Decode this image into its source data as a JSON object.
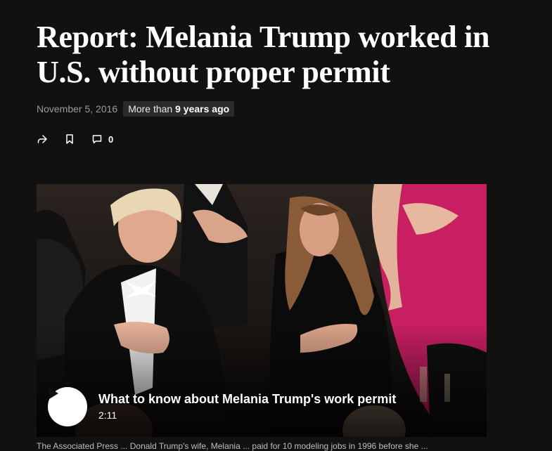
{
  "article": {
    "headline": "Report: Melania Trump worked in U.S. without proper permit",
    "date": "November 5, 2016",
    "age_prefix": "More than ",
    "age_value": "9 years ago"
  },
  "actions": {
    "share_icon": "share-icon",
    "bookmark_icon": "bookmark-icon",
    "comment_icon": "comment-icon",
    "comment_count": "0"
  },
  "video": {
    "title": "What to know about Melania Trump's work permit",
    "duration": "2:11",
    "play_icon": "play-icon"
  },
  "caption": "The Associated Press ... Donald Trump's wife, Melania ... paid for 10 modeling jobs in 1996 before she ...",
  "colors": {
    "background": "#111111",
    "text": "#ffffff",
    "muted": "#9a9a9a",
    "badge_bg": "#2a2a2a"
  }
}
